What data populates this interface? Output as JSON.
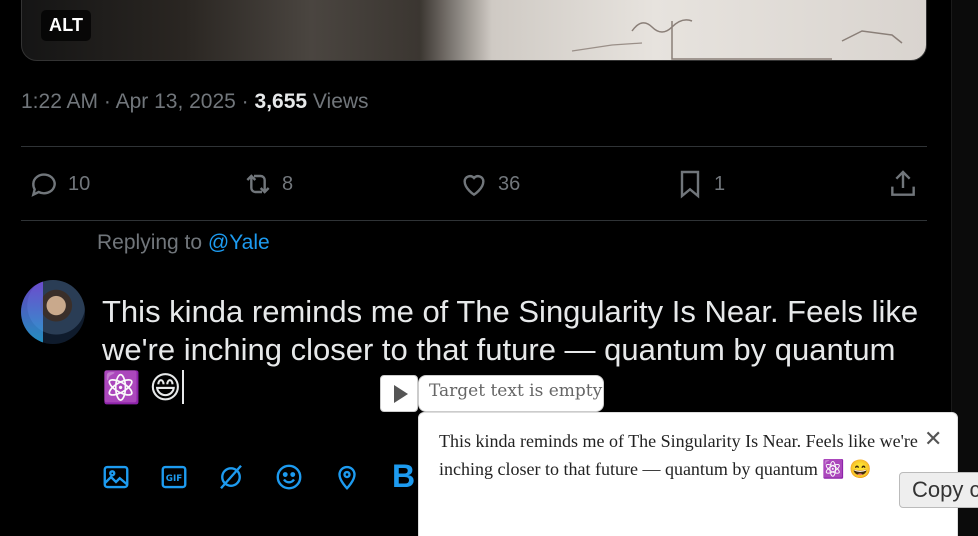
{
  "media": {
    "alt_badge": "ALT"
  },
  "meta": {
    "time": "1:22 AM",
    "sep1": " · ",
    "date": "Apr 13, 2025",
    "sep2": " · ",
    "views_count": "3,655",
    "views_label": " Views"
  },
  "actions": {
    "reply_count": "10",
    "retweet_count": "8",
    "like_count": "36",
    "bookmark_count": "1"
  },
  "reply": {
    "prefix": "Replying to ",
    "handle": "@Yale"
  },
  "compose": {
    "text": "This kinda reminds me of The Singularity Is Near. Feels like we're inching closer to that future — quantum by quantum ⚛️ 😄"
  },
  "toolbar": {
    "bold_label": "B"
  },
  "translator": {
    "target_status": "Target text is empty",
    "source_text": "This kinda reminds me of The Singularity Is Near. Feels like we're inching closer to that future — quantum by quantum ⚛️ 😄",
    "close_glyph": "✕",
    "copy_label": "Copy c"
  }
}
